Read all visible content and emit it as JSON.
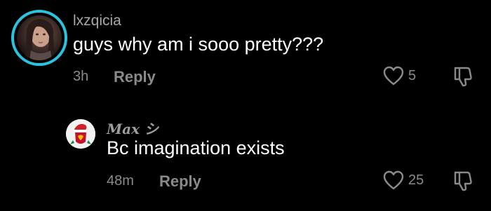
{
  "comments": [
    {
      "username": "lxzqicia",
      "text": "guys why am i sooo pretty???",
      "time": "3h",
      "reply_label": "Reply",
      "likes": "5"
    }
  ],
  "replies": [
    {
      "username": "Max シ",
      "text": "Bc imagination exists",
      "time": "48m",
      "reply_label": "Reply",
      "likes": "25"
    }
  ],
  "colors": {
    "background": "#000000",
    "avatar_ring": "#2bc4e0",
    "secondary_text": "#8a8a8a",
    "primary_text": "#ffffff"
  },
  "icons": {
    "like": "heart-outline-icon",
    "dislike": "thumbs-down-outline-icon"
  }
}
